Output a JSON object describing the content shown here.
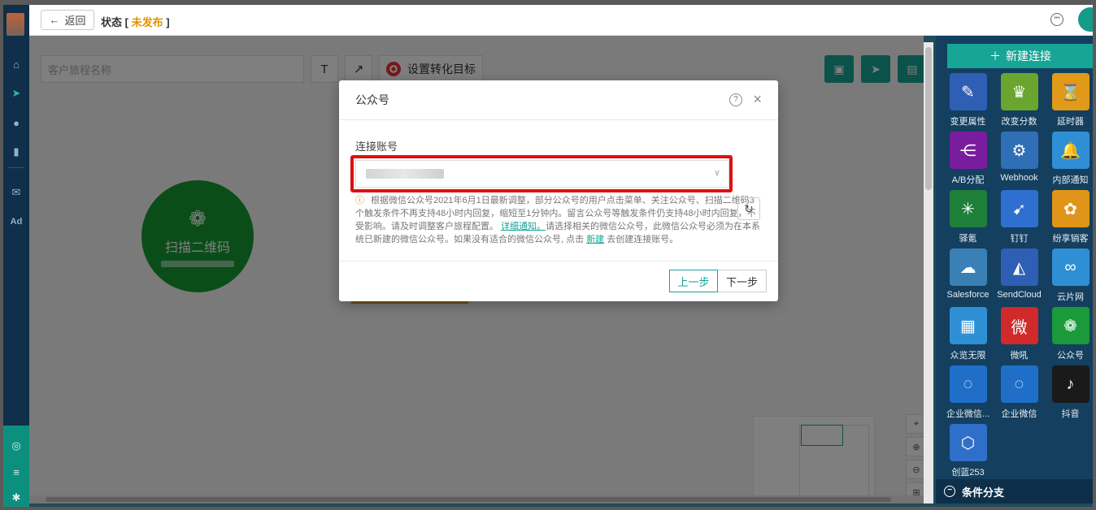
{
  "topbar": {
    "back_label": "返回",
    "status_prefix": "状态 [",
    "status_value": "未发布",
    "status_suffix": "]"
  },
  "canvas": {
    "name_placeholder": "客户旅程名称",
    "text_tool": "T",
    "arrow_tool": "↗",
    "goal_label": "设置转化目标",
    "node_qr_label": "扫描二维码"
  },
  "panel": {
    "new_connection": "新建连接",
    "items": [
      {
        "label": "变更属性",
        "color": "#2f5fb5",
        "icon": "edit-icon"
      },
      {
        "label": "改变分数",
        "color": "#6aa52f",
        "icon": "trophy-icon"
      },
      {
        "label": "延时器",
        "color": "#e09a1a",
        "icon": "hourglass-icon"
      },
      {
        "label": "A/B分配",
        "color": "#7a1d9c",
        "icon": "split-icon"
      },
      {
        "label": "Webhook",
        "color": "#2f6fb5",
        "icon": "webhook-icon"
      },
      {
        "label": "内部通知",
        "color": "#2f8fd5",
        "icon": "bell-icon"
      },
      {
        "label": "驿氪",
        "color": "#1d7f3a",
        "icon": "spider-icon"
      },
      {
        "label": "钉钉",
        "color": "#2f6fd0",
        "icon": "dingtalk-icon"
      },
      {
        "label": "纷享销客",
        "color": "#e0951a",
        "icon": "fxiaoke-icon"
      },
      {
        "label": "Salesforce",
        "color": "#3a7fb5",
        "icon": "cloud-icon"
      },
      {
        "label": "SendCloud",
        "color": "#2f5fb5",
        "icon": "sendcloud-icon"
      },
      {
        "label": "云片网",
        "color": "#2f8fd5",
        "icon": "yunpian-icon"
      },
      {
        "label": "众览无限",
        "color": "#2f8fd5",
        "icon": "weidian-icon"
      },
      {
        "label": "微吼",
        "color": "#d02a2a",
        "icon": "vhall-icon"
      },
      {
        "label": "公众号",
        "color": "#1a9a3a",
        "icon": "wechat-icon"
      },
      {
        "label": "企业微信...",
        "color": "#1f6fc9",
        "icon": "wecom-icon"
      },
      {
        "label": "企业微信",
        "color": "#1f6fc9",
        "icon": "wecom-icon"
      },
      {
        "label": "抖音",
        "color": "#1a1a1a",
        "icon": "tiktok-icon"
      },
      {
        "label": "创蓝253",
        "color": "#2f6fc9",
        "icon": "chuanglan-icon"
      }
    ],
    "footer_label": "条件分支"
  },
  "dialog": {
    "title": "公众号",
    "field_label": "连接账号",
    "notice_text_1": "根据微信公众号2021年6月1日最新调整，部分公众号的用户点击菜单、关注公众号、扫描二维码3个触发条件不再支持48小时内回复，缩短至1分钟内。留言公众号等触发条件仍支持48小时内回复，不受影响。请及时调整客户旅程配置。",
    "notice_link_1": "详细通知。",
    "notice_text_2": "请选择相关的微信公众号，此微信公众号必须为在本系统已新建的微信公众号。如果没有适合的微信公众号, 点击",
    "notice_link_2": "新建",
    "notice_text_3": "去创建连接账号。",
    "prev_label": "上一步",
    "next_label": "下一步"
  },
  "colors": {
    "accent": "#16a596",
    "status": "#e09400",
    "highlight": "#e01010",
    "node": "#159a30"
  }
}
